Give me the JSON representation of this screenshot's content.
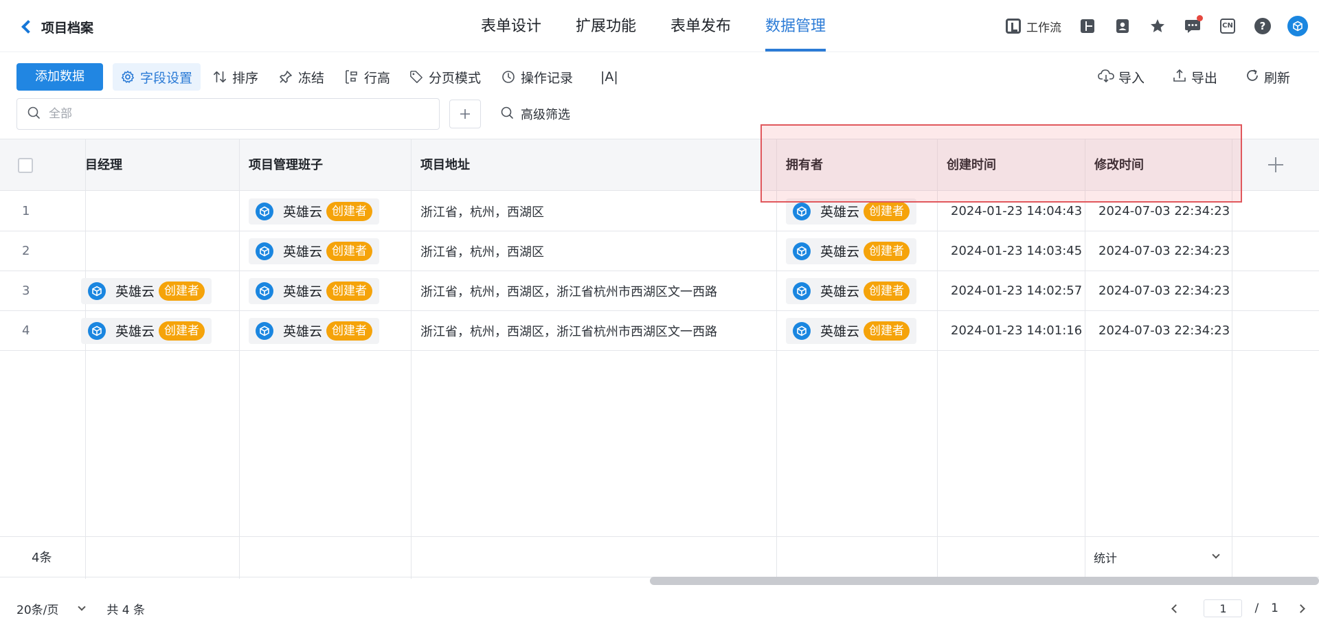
{
  "header": {
    "back_title": "项目档案",
    "tabs": [
      "表单设计",
      "扩展功能",
      "表单发布",
      "数据管理"
    ],
    "active_tab": "数据管理",
    "workflow_label": "工作流",
    "lang_badge": "CN",
    "help_glyph": "?"
  },
  "toolbar": {
    "add_data": "添加数据",
    "field_settings": "字段设置",
    "sort": "排序",
    "freeze": "冻结",
    "row_height": "行高",
    "paging_mode": "分页模式",
    "operation_log": "操作记录",
    "font_toggle": "|A|",
    "import": "导入",
    "export": "导出",
    "refresh": "刷新"
  },
  "filter": {
    "search_placeholder": "全部",
    "advanced_filter": "高级筛选"
  },
  "table": {
    "columns": {
      "manager": "目经理",
      "team": "项目管理班子",
      "address": "项目地址",
      "owner": "拥有者",
      "created": "创建时间",
      "modified": "修改时间"
    },
    "rows": [
      {
        "num": "1",
        "manager": "",
        "manager_badge": "",
        "team": "英雄云",
        "team_badge": "创建者",
        "address": "浙江省，杭州，西湖区",
        "owner": "英雄云",
        "owner_badge": "创建者",
        "created": "2024-01-23 14:04:43",
        "modified": "2024-07-03 22:34:23"
      },
      {
        "num": "2",
        "manager": "",
        "manager_badge": "",
        "team": "英雄云",
        "team_badge": "创建者",
        "address": "浙江省，杭州，西湖区",
        "owner": "英雄云",
        "owner_badge": "创建者",
        "created": "2024-01-23 14:03:45",
        "modified": "2024-07-03 22:34:23"
      },
      {
        "num": "3",
        "manager": "英雄云",
        "manager_badge": "创建者",
        "team": "英雄云",
        "team_badge": "创建者",
        "address": "浙江省，杭州，西湖区，浙江省杭州市西湖区文一西路",
        "owner": "英雄云",
        "owner_badge": "创建者",
        "created": "2024-01-23 14:02:57",
        "modified": "2024-07-03 22:34:23"
      },
      {
        "num": "4",
        "manager": "英雄云",
        "manager_badge": "创建者",
        "team": "英雄云",
        "team_badge": "创建者",
        "address": "浙江省，杭州，西湖区，浙江省杭州市西湖区文一西路",
        "owner": "英雄云",
        "owner_badge": "创建者",
        "created": "2024-01-23 14:01:16",
        "modified": "2024-07-03 22:34:23"
      }
    ],
    "footer_count": "4条",
    "stat_label": "统计"
  },
  "pagination": {
    "page_size": "20条/页",
    "total": "共 4 条",
    "current_page": "1",
    "slash": "/",
    "page_count": "1"
  },
  "colors": {
    "accent": "#2b7bd6",
    "primary_button": "#2186e2",
    "badge": "#f5a30a",
    "highlight_border": "#e0575c"
  }
}
